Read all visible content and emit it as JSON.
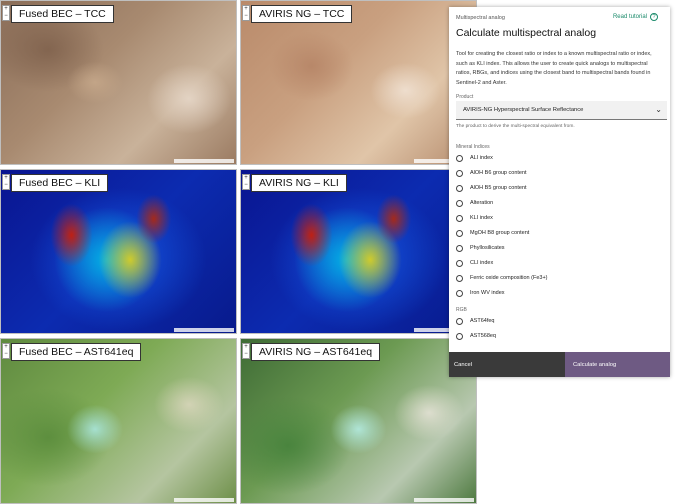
{
  "tiles": [
    {
      "label": "Fused BEC – TCC"
    },
    {
      "label": "AVIRIS NG – TCC"
    },
    {
      "label": "Fused BEC – KLI"
    },
    {
      "label": "AVIRIS NG – KLI"
    },
    {
      "label": "Fused BEC – AST641eq"
    },
    {
      "label": "AVIRIS NG – AST641eq"
    }
  ],
  "panel": {
    "overline": "Multispectral analog",
    "tutorial_label": "Read tutorial",
    "title": "Calculate multispectral analog",
    "description": "Tool for creating the closest ratio or index to a known multispectral ratio or index, such as KLI index. This allows the user to create quick analogs to multispectral ratios, RBGs, and indices using the closest band to multispectral bands found in Sentinel-2 and Aster.",
    "product_label": "Product",
    "product_value": "AVIRIS-NG Hyperspectral Surface Reflectance",
    "product_helper": "The product to derive the multi-spectral equivalent from.",
    "mineral_section": "Mineral Indices",
    "mineral_options": [
      "ALI index",
      "AlOH B6 group content",
      "AlOH B5 group content",
      "Alteration",
      "KLI index",
      "MgOH B8 group content",
      "Phyllosilicates",
      "CLI index",
      "Ferric oxide composition (Fe3+)",
      "Iron WV index"
    ],
    "rgb_section": "RGB",
    "rgb_options": [
      "AST64feq",
      "AST568eq"
    ],
    "cancel_label": "Cancel",
    "calculate_label": "Calculate analog"
  }
}
